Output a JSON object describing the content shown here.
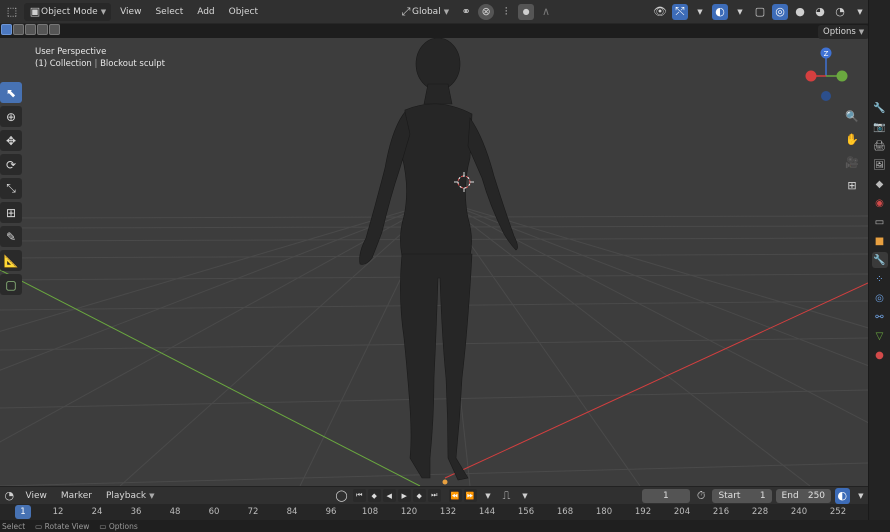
{
  "header": {
    "mode": "Object Mode",
    "menus": [
      "View",
      "Select",
      "Add",
      "Object"
    ],
    "transform_orientation": "Global"
  },
  "viewport": {
    "view_name": "User Perspective",
    "collection": "(1) Collection",
    "object": "Blockout sculpt",
    "options_label": "Options",
    "gizmo": {
      "z_label": "Z",
      "x_label": "X",
      "y_label": "Y"
    }
  },
  "timeline": {
    "menus": [
      "View",
      "Marker",
      "Playback"
    ],
    "current_frame": "1",
    "start_label": "Start",
    "start_value": "1",
    "end_label": "End",
    "end_value": "250",
    "ruler_current": "1",
    "ruler_ticks": [
      "12",
      "24",
      "36",
      "48",
      "60",
      "72",
      "84",
      "96",
      "108",
      "120",
      "132",
      "144",
      "156",
      "168",
      "180",
      "192",
      "204",
      "216",
      "228",
      "240",
      "252"
    ]
  },
  "status": {
    "items": [
      "Select",
      "Rotate View",
      "Options"
    ]
  },
  "colors": {
    "accent": "#4772b3",
    "axis_x": "#d43f3f",
    "axis_y": "#6aa83f",
    "axis_z": "#3f72d4"
  }
}
